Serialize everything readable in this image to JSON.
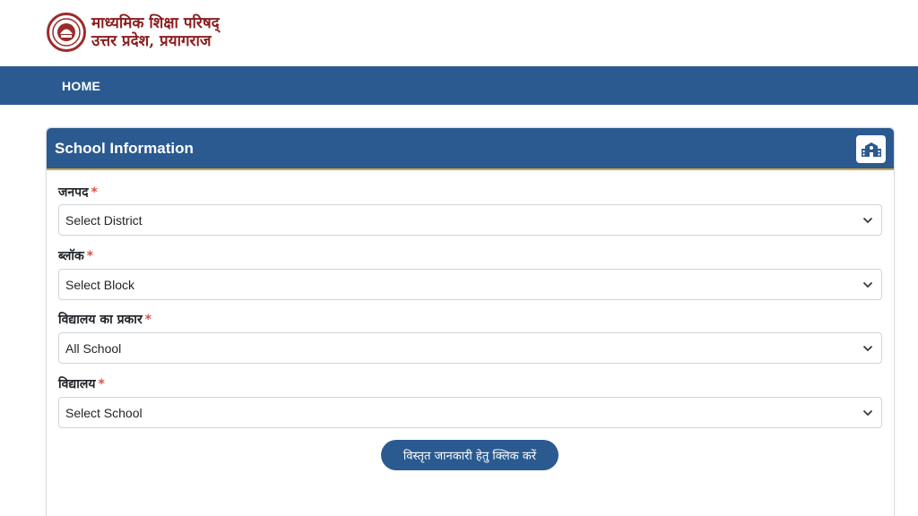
{
  "header": {
    "org_line1": "माध्यमिक शिक्षा परिषद्",
    "org_line2": "उत्तर प्रदेश, प्रयागराज",
    "logo_icon": "up-govt-seal-icon"
  },
  "navbar": {
    "home_label": "HOME"
  },
  "card": {
    "title": "School Information",
    "icon": "school-building-icon"
  },
  "form": {
    "fields": [
      {
        "label": "जनपद",
        "required_mark": "*",
        "selected": "Select District"
      },
      {
        "label": "ब्लॉक",
        "required_mark": "*",
        "selected": "Select Block"
      },
      {
        "label": "विद्यालय का प्रकार",
        "required_mark": "*",
        "selected": "All School"
      },
      {
        "label": "विद्यालय",
        "required_mark": "*",
        "selected": "Select School"
      }
    ],
    "submit_label": "विस्तृत जानकारी हेतु क्लिक करें"
  },
  "colors": {
    "primary": "#2a5a8f",
    "accent_line": "#d4a23a",
    "required": "#d9534f",
    "logo_red": "#8b1e1e"
  }
}
